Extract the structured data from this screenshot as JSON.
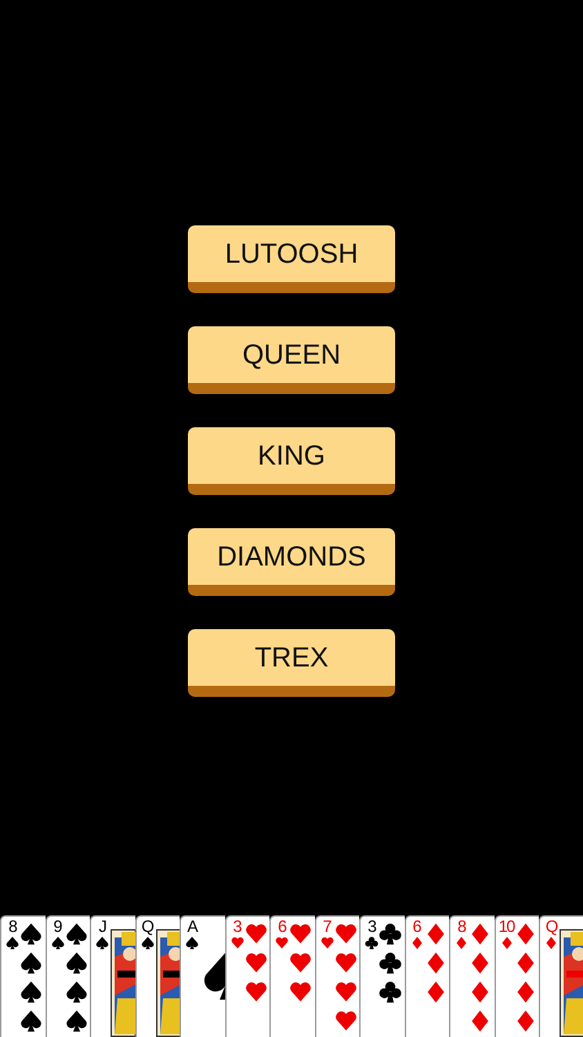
{
  "menu": [
    {
      "label": "LUTOOSH"
    },
    {
      "label": "QUEEN"
    },
    {
      "label": "KING"
    },
    {
      "label": "DIAMONDS"
    },
    {
      "label": "TREX"
    }
  ],
  "hand": [
    {
      "rank": "8",
      "kind": "spades",
      "court": false,
      "ace": false
    },
    {
      "rank": "9",
      "kind": "spades",
      "court": false,
      "ace": false
    },
    {
      "rank": "J",
      "kind": "spades",
      "court": true,
      "ace": false
    },
    {
      "rank": "Q",
      "kind": "spades",
      "court": true,
      "ace": false
    },
    {
      "rank": "A",
      "kind": "spades",
      "court": false,
      "ace": true
    },
    {
      "rank": "3",
      "kind": "hearts",
      "court": false,
      "ace": false
    },
    {
      "rank": "6",
      "kind": "hearts",
      "court": false,
      "ace": false
    },
    {
      "rank": "7",
      "kind": "hearts",
      "court": false,
      "ace": false
    },
    {
      "rank": "3",
      "kind": "clubs",
      "court": false,
      "ace": false
    },
    {
      "rank": "6",
      "kind": "diamonds",
      "court": false,
      "ace": false
    },
    {
      "rank": "8",
      "kind": "diamonds",
      "court": false,
      "ace": false
    },
    {
      "rank": "10",
      "kind": "diamonds",
      "court": false,
      "ace": false
    },
    {
      "rank": "Q",
      "kind": "diamonds",
      "court": true,
      "ace": false
    }
  ]
}
